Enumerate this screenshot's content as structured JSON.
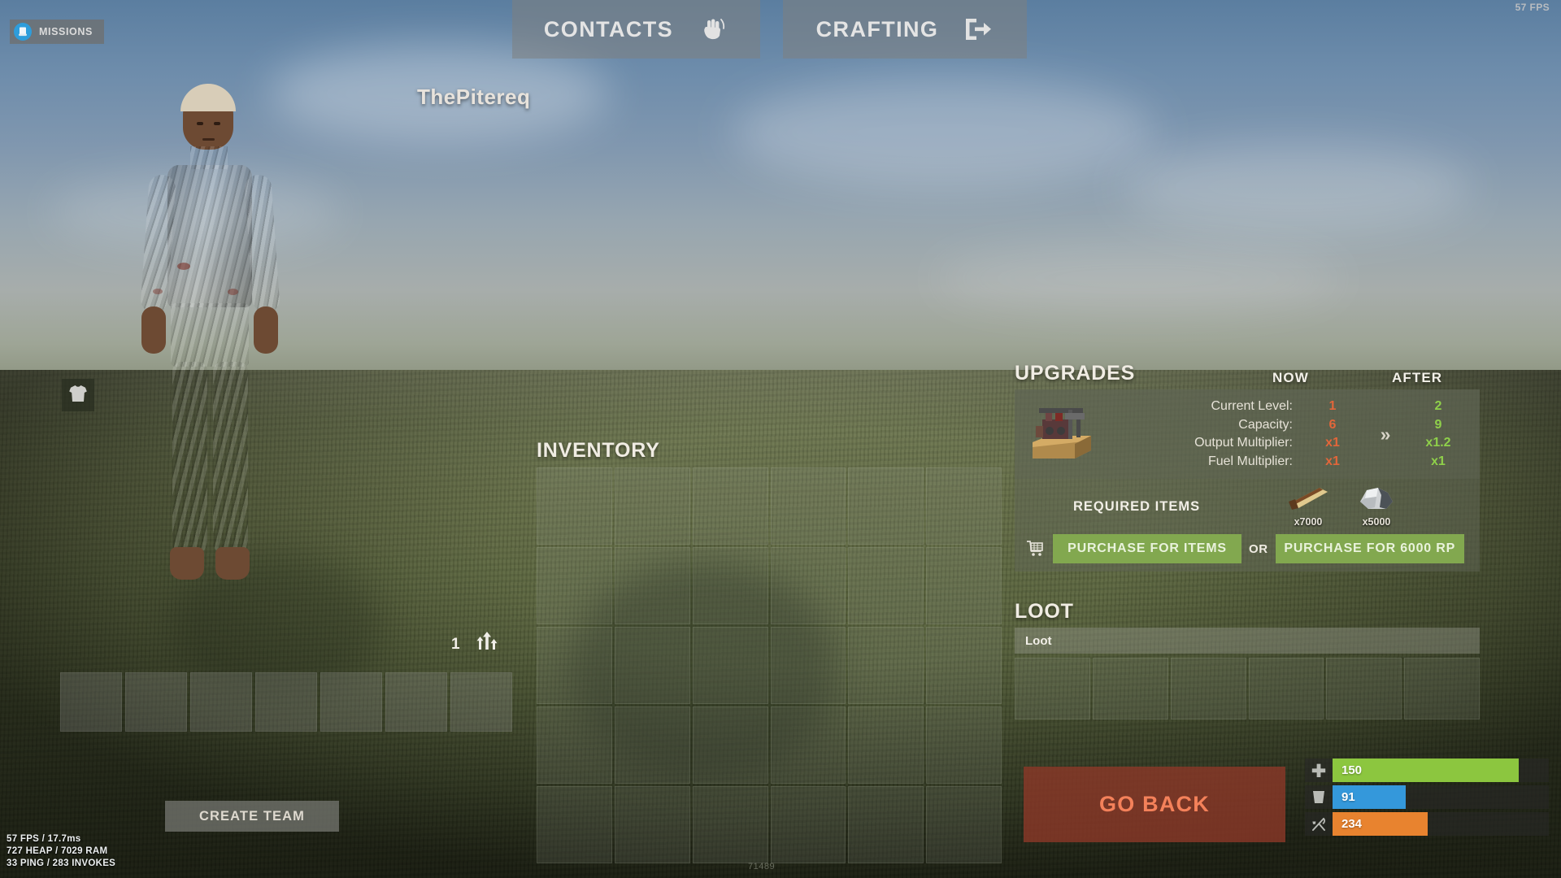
{
  "hud": {
    "missions_label": "MISSIONS",
    "missions_icon": "scroll-icon",
    "fps_top": "57 FPS",
    "player_name": "ThePitereq",
    "equip_slot_icon": "tshirt-icon",
    "armor_value": "1",
    "armor_icon": "three-arrows-up-icon",
    "create_team_label": "CREATE TEAM",
    "hotbar_slots": 7,
    "debug": {
      "line1": "57 FPS / 17.7ms",
      "line2": "727 HEAP / 7029 RAM",
      "line3": "33 PING / 283 INVOKES"
    }
  },
  "top_tabs": [
    {
      "label": "CONTACTS",
      "icon": "waving-hand-icon"
    },
    {
      "label": "CRAFTING",
      "icon": "exit-arrow-icon"
    }
  ],
  "inventory": {
    "title": "INVENTORY",
    "columns": 6,
    "rows": 5,
    "slots": 30,
    "watermark": "71489"
  },
  "upgrades": {
    "title": "UPGRADES",
    "col_now": "NOW",
    "col_after": "AFTER",
    "thumb_icon": "machine-icon",
    "arrow_icon": "double-chevron-right-icon",
    "stats": [
      {
        "label": "Current Level:",
        "now": "1",
        "after": "2"
      },
      {
        "label": "Capacity:",
        "now": "6",
        "after": "9"
      },
      {
        "label": "Output Multiplier:",
        "now": "x1",
        "after": "x1.2"
      },
      {
        "label": "Fuel Multiplier:",
        "now": "x1",
        "after": "x1"
      }
    ],
    "required_items_label": "REQUIRED ITEMS",
    "required_items": [
      {
        "icon": "wood-log-icon",
        "count": "x7000"
      },
      {
        "icon": "stone-ore-icon",
        "count": "x5000"
      }
    ],
    "cart_icon": "shopping-cart-icon",
    "buy_items_label": "PURCHASE FOR ITEMS",
    "or_label": "OR",
    "buy_rp_label": "PURCHASE FOR 6000 RP",
    "color_now": "#e2663a",
    "color_after": "#8fd04a",
    "color_buy_button": "#82a84f"
  },
  "loot": {
    "title": "LOOT",
    "bar_label": "Loot",
    "slots": 6
  },
  "go_back": {
    "label": "GO BACK",
    "color_bg": "#8c3828",
    "color_text": "#f4815a"
  },
  "status_bars": [
    {
      "name": "health",
      "icon": "cross-icon",
      "value": "150",
      "fill_pct": 86,
      "color": "#8cc63f"
    },
    {
      "name": "thirst",
      "icon": "glass-icon",
      "value": "91",
      "fill_pct": 34,
      "color": "#3498db"
    },
    {
      "name": "hunger",
      "icon": "cutlery-icon",
      "value": "234",
      "fill_pct": 44,
      "color": "#e8832f"
    }
  ]
}
